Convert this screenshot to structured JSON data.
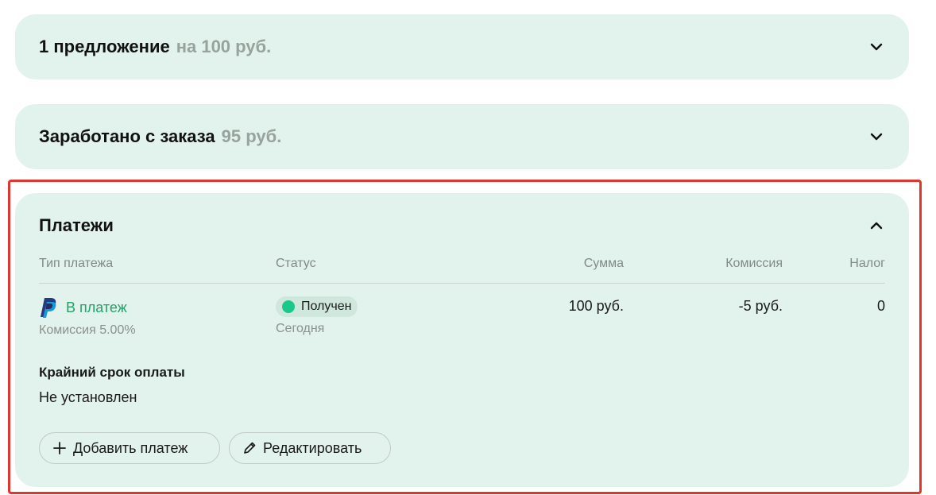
{
  "offers_card": {
    "title": "1 предложение",
    "amount": "на 100 руб.",
    "toggle_icon": "chevron-down-icon"
  },
  "earned_card": {
    "title": "Заработано с заказа",
    "amount": "95 руб.",
    "toggle_icon": "chevron-down-icon"
  },
  "payments_card": {
    "title": "Платежи",
    "toggle_icon": "chevron-up-icon",
    "highlight_color": "#e0342c",
    "columns": {
      "type": "Тип платежа",
      "status": "Статус",
      "sum": "Сумма",
      "fee": "Комиссия",
      "tax": "Налог"
    },
    "rows": [
      {
        "method_icon": "paypal-icon",
        "type_label": "В платеж",
        "type_sub": "Комиссия 5.00%",
        "status": "Получен",
        "status_color": "#19c98a",
        "status_date": "Сегодня",
        "sum": "100 руб.",
        "fee": "-5 руб.",
        "tax": "0"
      }
    ],
    "deadline_label": "Крайний срок оплаты",
    "deadline_value": "Не установлен",
    "add_payment_label": "Добавить платеж",
    "edit_label": "Редактировать"
  },
  "colors": {
    "card_bg": "#e2f2ec",
    "accent_green": "#1fa36b",
    "muted_text": "#98a39d"
  }
}
